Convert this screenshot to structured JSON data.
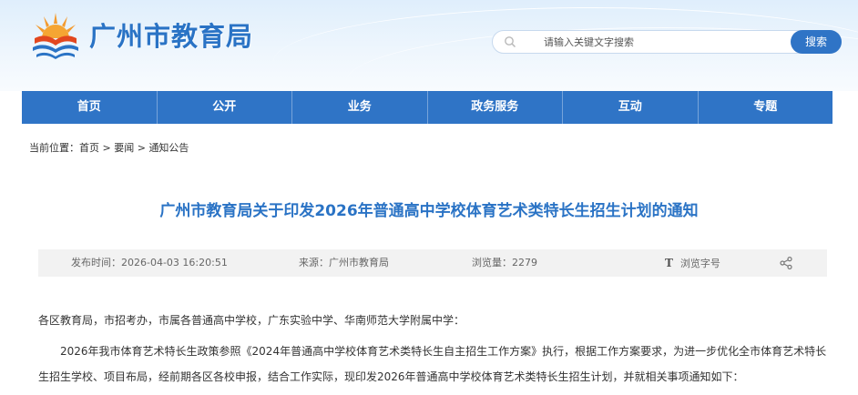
{
  "header": {
    "site_title": "广州市教育局",
    "logo_icon": "education-bureau-emblem",
    "search": {
      "placeholder": "请输入关键文字搜索",
      "value": "",
      "button_label": "搜索"
    }
  },
  "nav": {
    "items": [
      {
        "label": "首页"
      },
      {
        "label": "公开"
      },
      {
        "label": "业务"
      },
      {
        "label": "政务服务"
      },
      {
        "label": "互动"
      },
      {
        "label": "专题"
      }
    ]
  },
  "breadcrumb": {
    "prefix": "当前位置：",
    "items": [
      {
        "label": "首页"
      },
      {
        "label": "要闻"
      },
      {
        "label": "通知公告"
      }
    ],
    "separator": ">"
  },
  "article": {
    "title": "广州市教育局关于印发2026年普通高中学校体育艺术类特长生招生计划的通知",
    "meta": {
      "date": "发布时间：2026-04-03 16:20:51",
      "source": "来源：广州市教育局",
      "views": "浏览量：2279",
      "font_size_icon": "T",
      "font_size_label": "浏览字号"
    },
    "greeting": "各区教育局，市招考办，市属各普通高中学校，广东实验中学、华南师范大学附属中学：",
    "paragraph1_line1": "2026年我市体育艺术特长生政策参照《2024年普通高中学校体育艺术类特长生自主招生工作方案》执行，根据工作方案要求，为进一步优化全市体育艺术特长",
    "paragraph1_line2": "生招生学校、项目布局，经前期各区各校申报，结合工作实际，现印发2026年普通高中学校体育艺术类特长生招生计划，并就相关事项通知如下："
  },
  "colors": {
    "brand_blue": "#2f74c6",
    "title_blue": "#2a73c5",
    "meta_bg": "#f2f2f2"
  }
}
